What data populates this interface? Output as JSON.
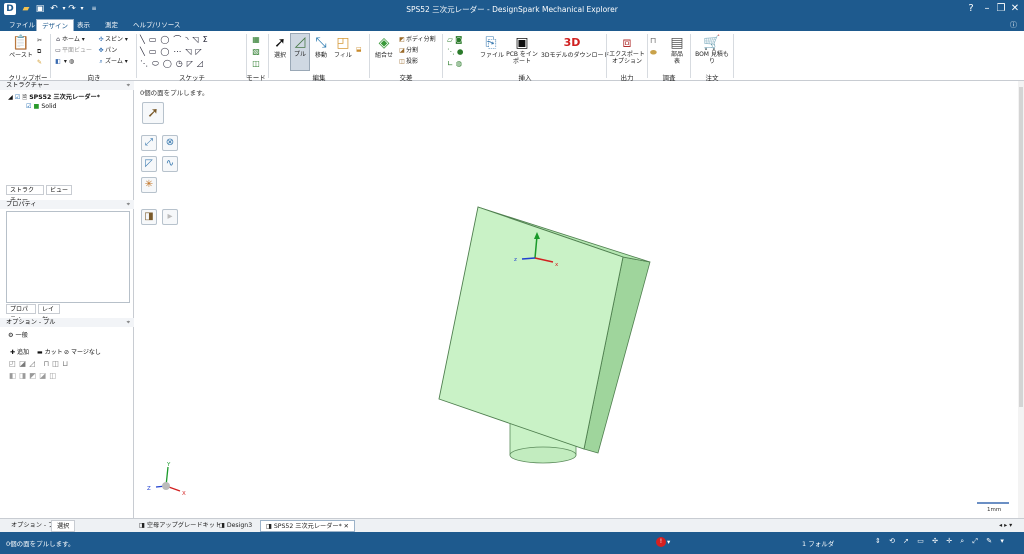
{
  "window": {
    "title": "SPS52 三次元レーダー - DesignSpark Mechanical Explorer",
    "quick_access": [
      "app-icon",
      "folder-icon",
      "save-icon",
      "undo-icon",
      "redo-icon",
      "customize-icon"
    ]
  },
  "ribbon_tabs": [
    "ファイル",
    "デザイン",
    "表示",
    "測定",
    "ヘルプ/リソース"
  ],
  "ribbon": {
    "clipboard": {
      "group": "クリップボード",
      "paste": "ペースト"
    },
    "orient": {
      "group": "向き",
      "home": "ホーム",
      "plane_view": "平面ビュー",
      "spin": "スピン",
      "pan": "パン",
      "zoom": "ズーム"
    },
    "sketch": {
      "group": "スケッチ"
    },
    "mode": {
      "group": "モード"
    },
    "edit": {
      "group": "編集",
      "select": "選択",
      "pull": "プル",
      "move": "移動",
      "fill": "フィル"
    },
    "intersect": {
      "group": "交差",
      "combine": "組合せ",
      "split_body": "ボディ分割",
      "split": "分割",
      "project": "投影"
    },
    "insert": {
      "group": "挿入",
      "file": "ファイル",
      "pcb_insert": "PCB をイン\nポート",
      "download_3d": "3Dモデルのダウンロード",
      "badge_3d": "3D"
    },
    "output": {
      "group": "出力",
      "export_options": "エクスポート\nオプション"
    },
    "investigate": {
      "group": "調査",
      "parts_list": "部品\n表"
    },
    "order": {
      "group": "注文",
      "bom": "BOM 見積も\nり"
    }
  },
  "structure": {
    "header": "ストラクチャー",
    "root": "SPS52 三次元レーダー*",
    "child": "Solid",
    "tabs": [
      "ストラクチャー",
      "ビュー"
    ]
  },
  "properties": {
    "header": "プロパティ",
    "tabs": [
      "プロパティ",
      "レイヤ"
    ]
  },
  "options": {
    "header": "オプション - プル",
    "general": "一般",
    "add": "追加",
    "cut": "カット",
    "no_merge": "マージなし"
  },
  "left_bottom_tabs": [
    "オプション - プル",
    "選択"
  ],
  "viewport": {
    "hint": "0個の面をプルします。",
    "scale": "1mm",
    "axes": {
      "x": "X",
      "y": "Y",
      "z": "Z"
    }
  },
  "doc_tabs": [
    "空母アップグレードキット",
    "Design3",
    "SPS52 三次元レーダー*"
  ],
  "status": {
    "left": "0個の面をプルします。",
    "folders": "1 フォルダ"
  },
  "colors": {
    "brand": "#1e5a8e",
    "model_fill": "#c9f2c6",
    "model_edge": "#5a8a5a"
  }
}
